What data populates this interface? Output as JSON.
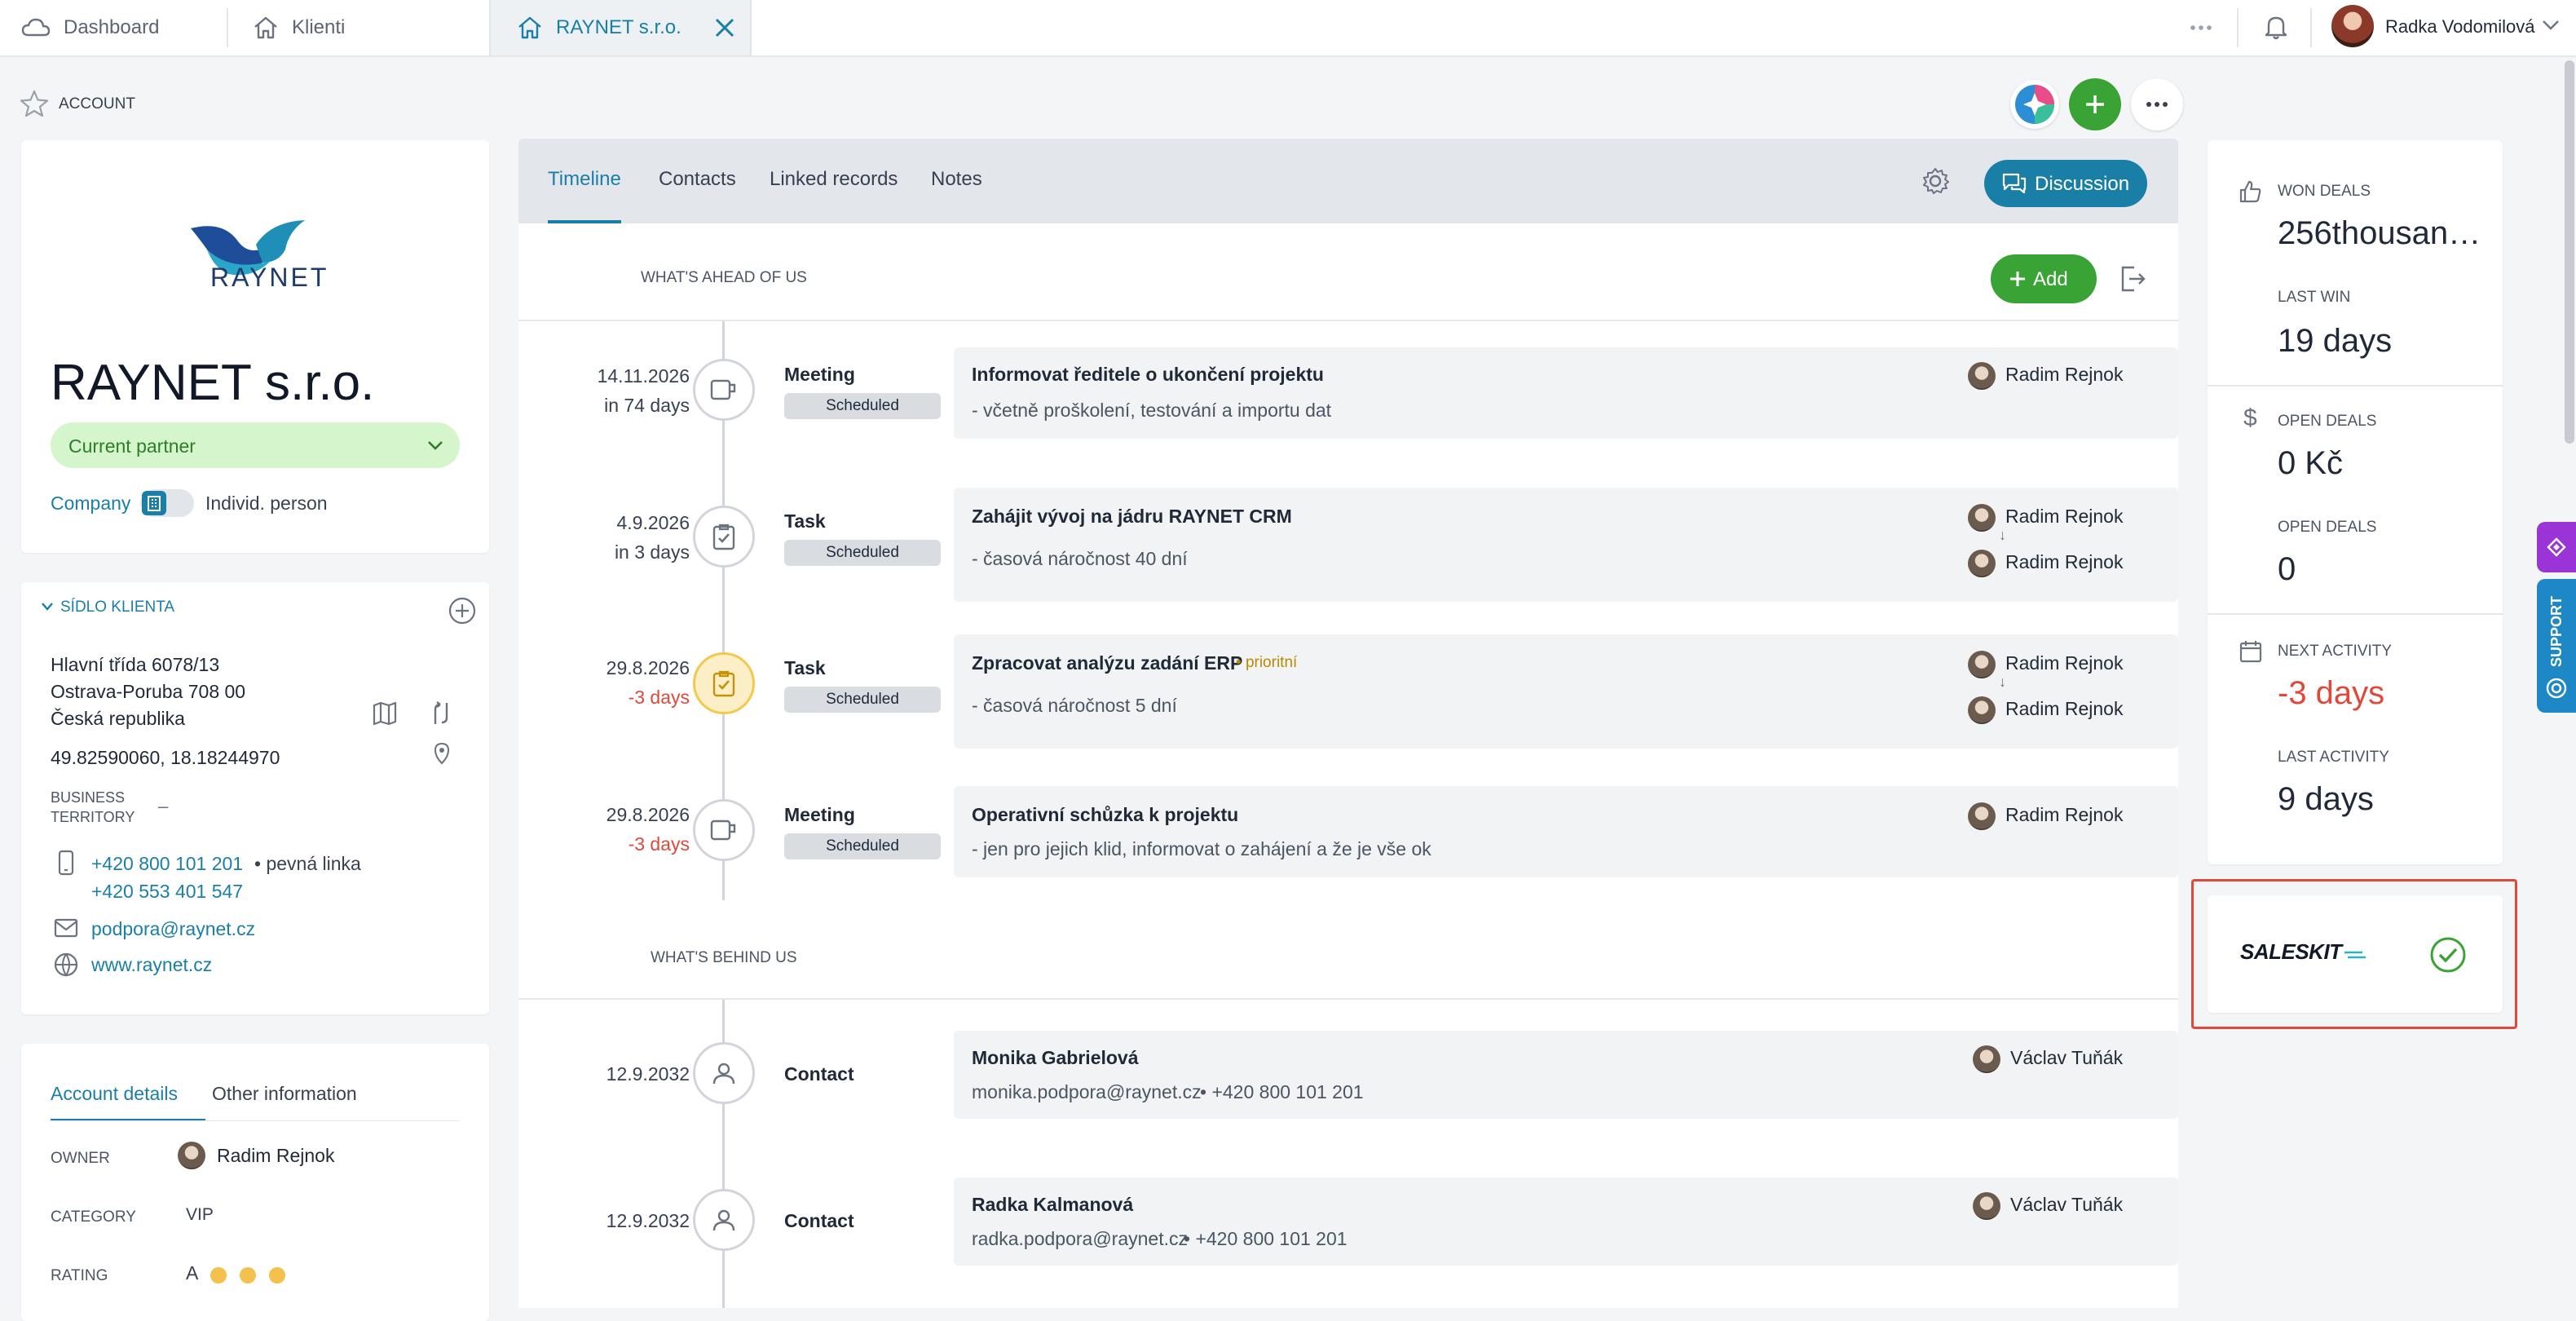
{
  "tabs": [
    {
      "label": "Dashboard",
      "icon": "cloud-icon"
    },
    {
      "label": "Klienti",
      "icon": "home-icon"
    },
    {
      "label": "RAYNET s.r.o.",
      "icon": "home-icon",
      "active": true
    }
  ],
  "user": {
    "name": "Radka Vodomilová"
  },
  "breadcrumb": "ACCOUNT",
  "company": {
    "logo_text": "RAYNET",
    "name": "RAYNET s.r.o.",
    "status": "Current partner",
    "type_company": "Company",
    "type_person": "Individ. person"
  },
  "address": {
    "section_title": "SÍDLO KLIENTA",
    "street": "Hlavní třída 6078/13",
    "city": "Ostrava-Poruba 708 00",
    "country": "Česká republika",
    "gps": "49.82590060, 18.18244970",
    "territory_label_1": "BUSINESS",
    "territory_label_2": "TERRITORY",
    "territory_value": "–",
    "phone1": "+420 800 101 201",
    "phone1_type": "pevná linka",
    "phone2": "+420 553 401 547",
    "email": "podpora@raynet.cz",
    "web": "www.raynet.cz"
  },
  "details": {
    "tab1": "Account details",
    "tab2": "Other information",
    "owner_label": "OWNER",
    "owner": "Radim Rejnok",
    "category_label": "CATEGORY",
    "category": "VIP",
    "rating_label": "RATING",
    "rating": "A"
  },
  "main_tabs": {
    "timeline": "Timeline",
    "contacts": "Contacts",
    "linked": "Linked records",
    "notes": "Notes",
    "discussion": "Discussion"
  },
  "ahead": {
    "title": "WHAT'S AHEAD OF US",
    "add_label": "Add",
    "items": [
      {
        "date": "14.11.2026",
        "rel": "in 74 days",
        "type": "Meeting",
        "status": "Scheduled",
        "title": "Informovat ředitele o ukončení projektu",
        "note": "- včetně proškolení, testování a importu dat",
        "owner": "Radim Rejnok"
      },
      {
        "date": "4.9.2026",
        "rel": "in 3 days",
        "type": "Task",
        "status": "Scheduled",
        "title": "Zahájit vývoj na jádru RAYNET CRM",
        "note": "- časová náročnost 40 dní",
        "owner": "Radim Rejnok",
        "assignee": "Radim Rejnok"
      },
      {
        "date": "29.8.2026",
        "rel": "-3 days",
        "type": "Task",
        "status": "Scheduled",
        "title": "Zpracovat analýzu zadání ERP",
        "priority": "prioritní",
        "note": "- časová náročnost 5 dní",
        "owner": "Radim Rejnok",
        "assignee": "Radim Rejnok"
      },
      {
        "date": "29.8.2026",
        "rel": "-3 days",
        "type": "Meeting",
        "status": "Scheduled",
        "title": "Operativní schůzka k projektu",
        "note": "- jen pro jejich klid, informovat o zahájení a že je vše ok",
        "owner": "Radim Rejnok"
      }
    ]
  },
  "behind": {
    "title": "WHAT'S BEHIND US",
    "items": [
      {
        "date": "12.9.2032",
        "type": "Contact",
        "name": "Monika Gabrielová",
        "email": "monika.podpora@raynet.cz",
        "phone": "+420 800 101 201",
        "owner": "Václav Tuňák"
      },
      {
        "date": "12.9.2032",
        "type": "Contact",
        "name": "Radka Kalmanová",
        "email": "radka.podpora@raynet.cz",
        "phone": "+420 800 101 201",
        "owner": "Václav Tuňák"
      }
    ]
  },
  "stats": {
    "won_deals_label": "WON DEALS",
    "won_deals": "256thousan…",
    "last_win_label": "LAST WIN",
    "last_win": "19 days",
    "open_deals_label": "OPEN DEALS",
    "open_deals_value": "0 Kč",
    "open_deals_label2": "OPEN DEALS",
    "open_deals_count": "0",
    "next_activity_label": "NEXT ACTIVITY",
    "next_activity": "-3 days",
    "last_activity_label": "LAST ACTIVITY",
    "last_activity": "9 days"
  },
  "saleskit": {
    "logo": "SALESKIT"
  },
  "support": "SUPPORT",
  "colors": {
    "accent": "#1a7fa6",
    "green": "#3aa335",
    "red": "#e0493a",
    "highlight_border": "#e0493a"
  }
}
